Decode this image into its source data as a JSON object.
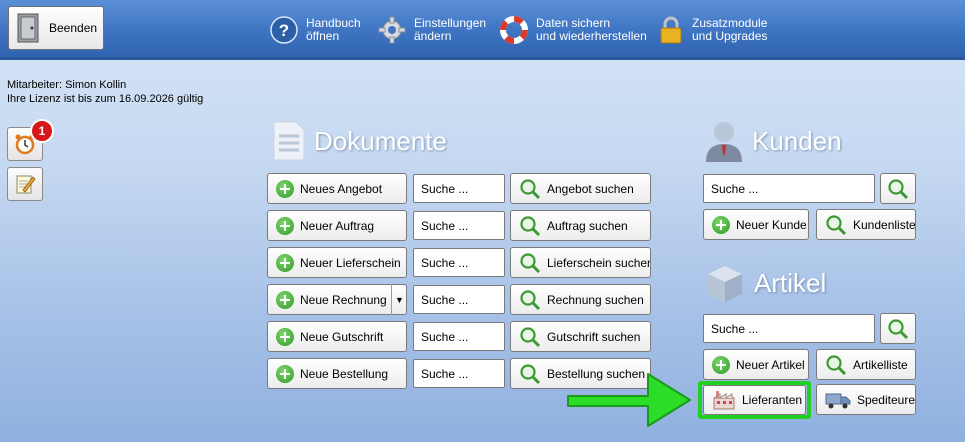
{
  "toolbar": {
    "exit_label": "Beenden",
    "items": [
      {
        "line1": "Handbuch",
        "line2": "öffnen",
        "icon": "help-icon"
      },
      {
        "line1": "Einstellungen",
        "line2": "ändern",
        "icon": "gear-icon"
      },
      {
        "line1": "Daten sichern",
        "line2": "und wiederherstellen",
        "icon": "lifebuoy-icon"
      },
      {
        "line1": "Zusatzmodule",
        "line2": "und Upgrades",
        "icon": "lock-icon"
      }
    ]
  },
  "info": {
    "employee": "Mitarbeiter: Simon Kollin",
    "license": "Ihre Lizenz ist bis zum 16.09.2026 gültig"
  },
  "sidebar": {
    "reminder_count": "1"
  },
  "documents": {
    "title": "Dokumente",
    "rows": [
      {
        "new_label": "Neues Angebot",
        "search_placeholder": "Suche ...",
        "search_label": "Angebot suchen"
      },
      {
        "new_label": "Neuer Auftrag",
        "search_placeholder": "Suche ...",
        "search_label": "Auftrag suchen"
      },
      {
        "new_label": "Neuer Lieferschein",
        "search_placeholder": "Suche ...",
        "search_label": "Lieferschein suchen"
      },
      {
        "new_label": "Neue Rechnung",
        "search_placeholder": "Suche ...",
        "search_label": "Rechnung suchen"
      },
      {
        "new_label": "Neue Gutschrift",
        "search_placeholder": "Suche ...",
        "search_label": "Gutschrift suchen"
      },
      {
        "new_label": "Neue Bestellung",
        "search_placeholder": "Suche ...",
        "search_label": "Bestellung suchen"
      }
    ]
  },
  "customers": {
    "title": "Kunden",
    "search_placeholder": "Suche ...",
    "new_label": "Neuer Kunde",
    "list_label": "Kundenliste"
  },
  "articles": {
    "title": "Artikel",
    "search_placeholder": "Suche ...",
    "new_label": "Neuer Artikel",
    "list_label": "Artikelliste",
    "suppliers_label": "Lieferanten",
    "forwarders_label": "Spediteure"
  },
  "colors": {
    "toolbar": "#3e74c2",
    "highlight": "#22d11f",
    "badge": "#d81818"
  }
}
